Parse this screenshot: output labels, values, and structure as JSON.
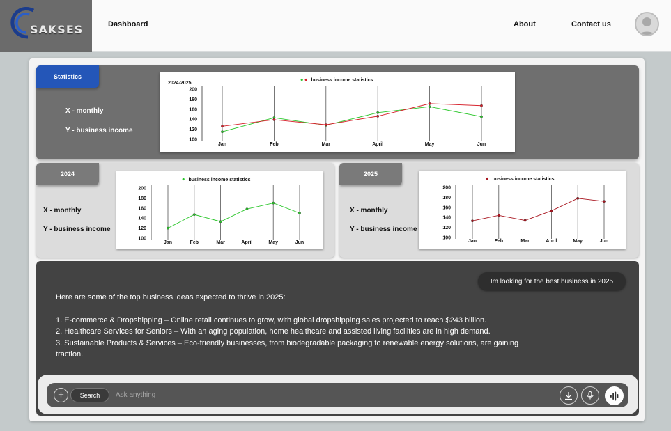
{
  "header": {
    "logo_text": "SAKSES",
    "nav": {
      "dashboard": "Dashboard",
      "about": "About",
      "contact": "Contact us"
    }
  },
  "statistics": {
    "tab_label": "Statistics",
    "x_label": "X - monthly",
    "y_label": "Y - business income"
  },
  "panel_2024": {
    "tab_label": "2024",
    "x_label": "X - monthly",
    "y_label": "Y - business income"
  },
  "panel_2025": {
    "tab_label": "2025",
    "x_label": "X - monthly",
    "y_label": "Y - business income"
  },
  "colors": {
    "green": "#29c629",
    "red": "#d6202a",
    "accent_blue": "#2456b8"
  },
  "chart_data": [
    {
      "type": "line",
      "title": "business income statistics",
      "corner_label": "2024-2025",
      "categories": [
        "Jan",
        "Feb",
        "Mar",
        "April",
        "May",
        "Jun"
      ],
      "yticks": [
        100,
        120,
        140,
        160,
        180,
        200
      ],
      "ylim": [
        100,
        200
      ],
      "series": [
        {
          "values": [
            115,
            143,
            128,
            153,
            165,
            145
          ],
          "color": "#29c629"
        },
        {
          "values": [
            126,
            139,
            129,
            146,
            171,
            167
          ],
          "color": "#d6202a"
        }
      ]
    },
    {
      "type": "line",
      "title": "business income statistics",
      "categories": [
        "Jan",
        "Feb",
        "Mar",
        "April",
        "May",
        "Jun"
      ],
      "yticks": [
        100,
        120,
        140,
        160,
        180,
        200
      ],
      "ylim": [
        100,
        200
      ],
      "series": [
        {
          "values": [
            120,
            147,
            133,
            158,
            170,
            150
          ],
          "color": "#29c629"
        }
      ]
    },
    {
      "type": "line",
      "title": "business income statistics",
      "categories": [
        "Jan",
        "Feb",
        "Mar",
        "April",
        "May",
        "Jun"
      ],
      "yticks": [
        100,
        120,
        140,
        160,
        180,
        200
      ],
      "ylim": [
        100,
        200
      ],
      "series": [
        {
          "values": [
            133,
            144,
            134,
            153,
            178,
            172
          ],
          "color": "#a8141e"
        }
      ]
    }
  ],
  "chat": {
    "user_message": "Im looking for the  best business in 2025",
    "intro": "Here are some of the top business ideas expected to thrive in 2025:",
    "items": [
      "1. E-commerce & Dropshipping – Online retail continues to grow, with global dropshipping sales projected to reach $243 billion.",
      "2. Healthcare Services for Seniors – With an aging population, home healthcare and assisted living facilities are in high demand.",
      "3. Sustainable Products & Services – Eco-friendly businesses, from biodegradable packaging to renewable energy solutions, are gaining traction."
    ]
  },
  "composer": {
    "plus_label": "+",
    "search_label": "Search",
    "placeholder": "Ask anything"
  }
}
